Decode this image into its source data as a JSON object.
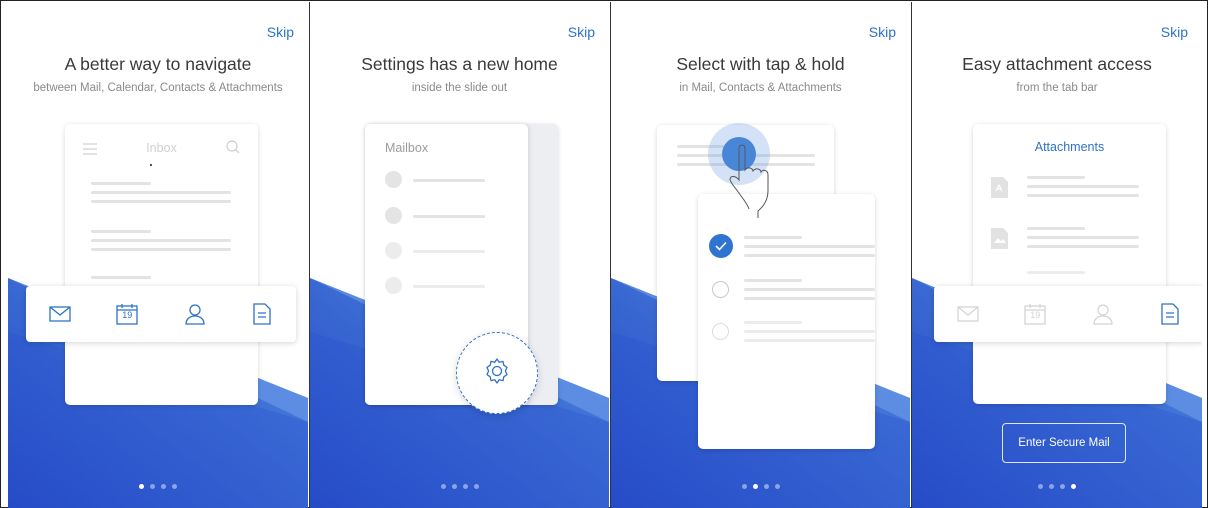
{
  "colors": {
    "accent": "#2d72c8",
    "gradient_deep": "#2a50c8",
    "gradient_light": "#5b8be6",
    "check": "#2f74d0"
  },
  "pages": [
    {
      "skip": "Skip",
      "title": "A better way to navigate",
      "subtitle": "between Mail, Calendar, Contacts & Attachments",
      "card_title": "Inbox",
      "calendar_day": "19",
      "icons": [
        "menu-icon",
        "search-icon",
        "mail-icon",
        "calendar-icon",
        "contacts-icon",
        "document-icon"
      ],
      "active_dot": 0
    },
    {
      "skip": "Skip",
      "title": "Settings has a new home",
      "subtitle": "inside the slide out",
      "card_title": "Mailbox",
      "icons": [
        "gear-icon"
      ],
      "active_dot": 0
    },
    {
      "skip": "Skip",
      "title": "Select with tap & hold",
      "subtitle": "in Mail, Contacts & Attachments",
      "icons": [
        "tap-hand-icon",
        "checkmark-icon",
        "radio-icon"
      ],
      "active_dot": 1
    },
    {
      "skip": "Skip",
      "title": "Easy attachment access",
      "subtitle": "from the tab bar",
      "card_title": "Attachments",
      "calendar_day": "19",
      "button": "Enter Secure Mail",
      "icons": [
        "pdf-icon",
        "image-icon",
        "mail-icon",
        "calendar-icon",
        "contacts-icon",
        "document-icon"
      ],
      "active_dot": 3
    }
  ]
}
